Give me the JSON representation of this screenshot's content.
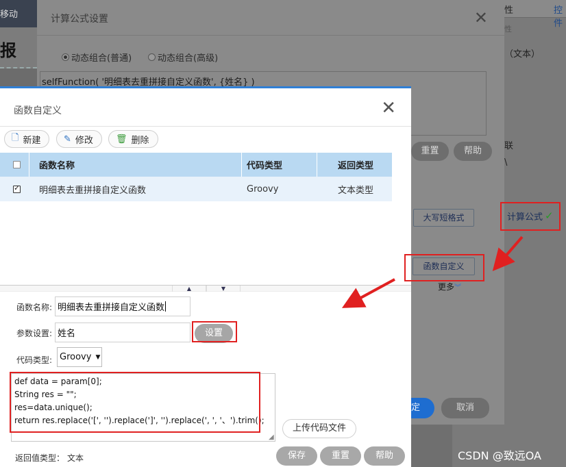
{
  "background": {
    "left_top_text": "移动",
    "left_mid_text": "报",
    "right_tabs": [
      "性",
      "控件"
    ],
    "right_sub": "性",
    "right_text_type": "（文本）",
    "right_link": "联",
    "right_mark": "\\"
  },
  "outer_dialog": {
    "title": "计算公式设置",
    "radio_normal": "动态组合(普通)",
    "radio_advanced": "动态组合(高级)",
    "formula": "selfFunction( '明细表去重拼接自定义函数', {姓名} )",
    "formula_fn": "selfFunction",
    "formula_rest": "( '明细表去重拼接自定义函数', {姓名} )",
    "reset_label": "重置",
    "help_label": "帮助",
    "upper_format_label": "大写短格式",
    "custom_func_label": "函数自定义",
    "more_label": "更多",
    "confirm_label": "定",
    "cancel_label": "取消",
    "calc_formula_label": "计算公式"
  },
  "inner_dialog": {
    "title": "函数自定义",
    "toolbar": {
      "new_label": "新建",
      "edit_label": "修改",
      "delete_label": "删除"
    },
    "grid": {
      "headers": [
        "函数名称",
        "代码类型",
        "返回类型"
      ],
      "rows": [
        {
          "name": "明细表去重拼接自定义函数",
          "code_type": "Groovy",
          "return_type": "文本类型",
          "checked": true
        }
      ]
    },
    "form": {
      "name_label": "函数名称:",
      "name_value": "明细表去重拼接自定义函数",
      "param_label": "参数设置:",
      "param_value": "姓名",
      "set_label": "设置",
      "code_type_label": "代码类型:",
      "code_type_value": "Groovy",
      "code": "def data = param[0];\nString res = \"\";\nres=data.unique();\nreturn res.replace('[', '').replace(']', '').replace(', ', '、').trim();",
      "upload_label": "上传代码文件",
      "return_type_label": "返回值类型：",
      "return_type_value": "文本",
      "save_label": "保存",
      "reset_label": "重置",
      "help_label": "帮助"
    }
  },
  "watermark": "CSDN @致远OA",
  "colors": {
    "accent_blue": "#2f7fd6",
    "grid_header": "#b9d9f2",
    "annotation_red": "#e02020"
  }
}
